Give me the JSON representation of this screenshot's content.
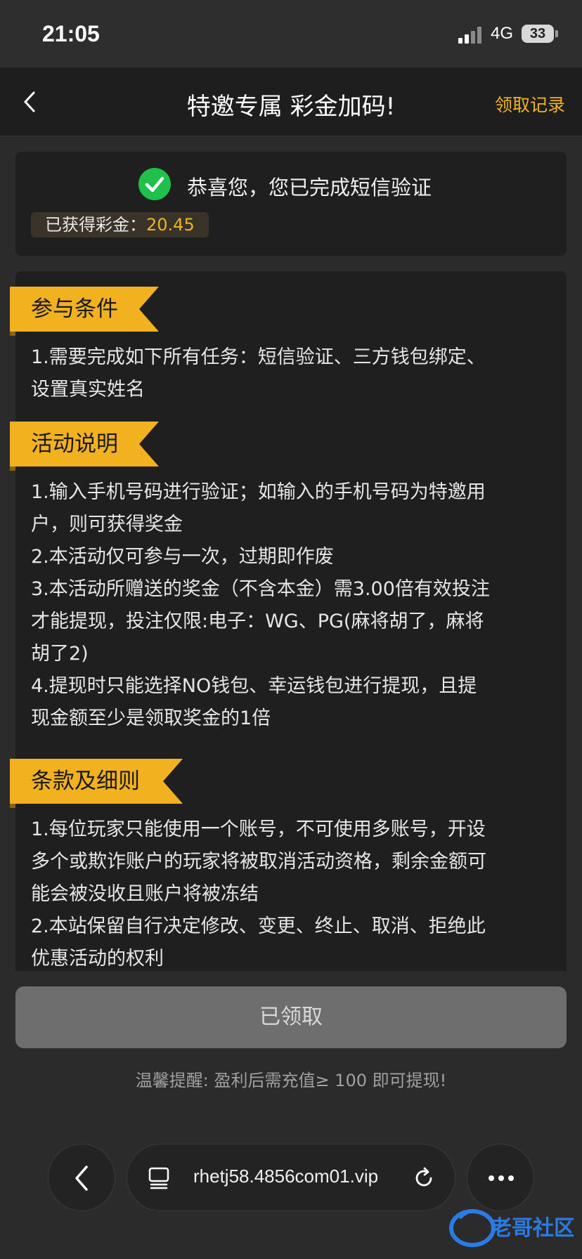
{
  "status_bar": {
    "time": "21:05",
    "network": "4G",
    "battery": "33"
  },
  "header": {
    "back_icon": "chevron-left-icon",
    "title": "特邀专属 彩金加码!",
    "records_link": "领取记录"
  },
  "verification": {
    "icon": "check-circle-icon",
    "message": "恭喜您，您已完成短信验证",
    "earned_label": "已获得彩金：",
    "earned_value": "20.45"
  },
  "sections": [
    {
      "title": "参与条件",
      "lines": [
        "1.需要完成如下所有任务：短信验证、三方钱包绑定、",
        "设置真实姓名"
      ]
    },
    {
      "title": "活动说明",
      "lines": [
        "1.输入手机号码进行验证；如输入的手机号码为特邀用",
        "户，则可获得奖金",
        "2.本活动仅可参与一次，过期即作废",
        "3.本活动所赠送的奖金（不含本金）需3.00倍有效投注",
        "才能提现，投注仅限:电子：WG、PG(麻将胡了，麻将",
        "胡了2)",
        "4.提现时只能选择NO钱包、幸运钱包进行提现，且提",
        "现金额至少是领取奖金的1倍"
      ]
    },
    {
      "title": "条款及细则",
      "lines": [
        "1.每位玩家只能使用一个账号，不可使用多账号，开设",
        "多个或欺诈账户的玩家将被取消活动资格，剩余金额可",
        "能会被没收且账户将被冻结",
        "2.本站保留自行决定修改、变更、终止、取消、拒绝此",
        "优惠活动的权利"
      ]
    }
  ],
  "bottom": {
    "claimed_button": "已领取",
    "reminder": "温馨提醒: 盈利后需充值≥ 100 即可提现!"
  },
  "browser": {
    "url": "rhetj58.4856com01.vip",
    "back_icon": "chevron-left-icon",
    "tabs_icon": "tabs-icon",
    "reload_icon": "reload-icon",
    "more_icon": "more-dots-icon"
  },
  "watermark_text": "老哥社区",
  "colors": {
    "accent": "#f2b21f",
    "success": "#1fc14b",
    "card": "#1f1f1f",
    "background": "#2b2b2b"
  }
}
